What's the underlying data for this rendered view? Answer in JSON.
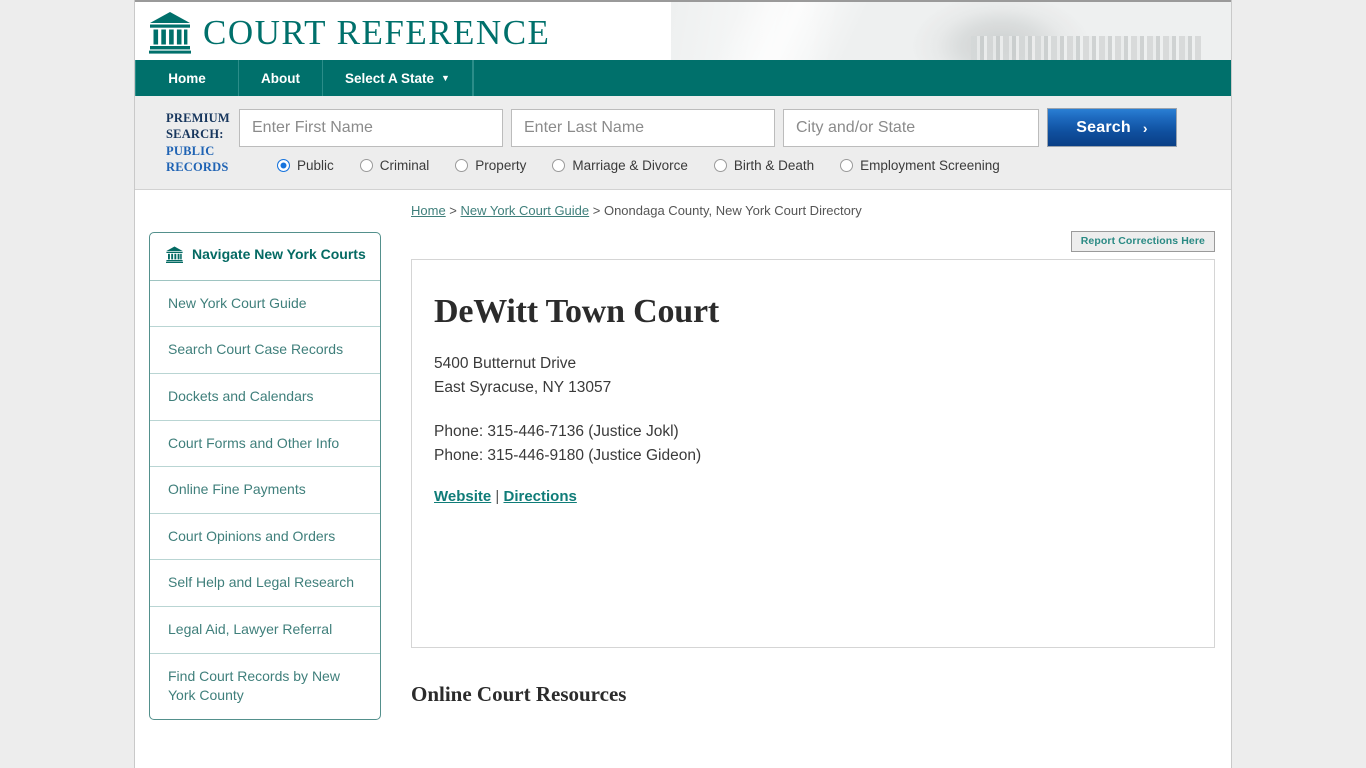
{
  "site": {
    "brand_name": "COURT REFERENCE",
    "brand_icon": "courthouse-icon"
  },
  "nav": {
    "items": [
      {
        "label": "Home"
      },
      {
        "label": "About"
      },
      {
        "label": "Select A State",
        "caret": "▼"
      }
    ]
  },
  "premium_search": {
    "label_line1": "PREMIUM",
    "label_line2": "SEARCH:",
    "label_line3": "PUBLIC",
    "label_line4": "RECORDS",
    "first_name_placeholder": "Enter First Name",
    "first_name_value": "",
    "last_name_placeholder": "Enter Last Name",
    "last_name_value": "",
    "city_state_placeholder": "City and/or State",
    "city_state_value": "",
    "search_button": "Search",
    "search_button_chevron": "›",
    "options": [
      {
        "label": "Public",
        "selected": true
      },
      {
        "label": "Criminal",
        "selected": false
      },
      {
        "label": "Property",
        "selected": false
      },
      {
        "label": "Marriage & Divorce",
        "selected": false
      },
      {
        "label": "Birth & Death",
        "selected": false
      },
      {
        "label": "Employment Screening",
        "selected": false
      }
    ]
  },
  "breadcrumb": {
    "home": "Home",
    "sep1": " > ",
    "guide": "New York Court Guide",
    "sep2": " > ",
    "current": "Onondaga County, New York Court Directory"
  },
  "corrections_button": "Report Corrections Here",
  "sidebar": {
    "heading": "Navigate New York Courts",
    "heading_icon": "courthouse-icon",
    "items": [
      {
        "label": "New York Court Guide"
      },
      {
        "label": "Search Court Case Records"
      },
      {
        "label": "Dockets and Calendars"
      },
      {
        "label": "Court Forms and Other Info"
      },
      {
        "label": "Online Fine Payments"
      },
      {
        "label": "Court Opinions and Orders"
      },
      {
        "label": "Self Help and Legal Research"
      },
      {
        "label": "Legal Aid, Lawyer Referral"
      },
      {
        "label": "Find Court Records by New York County"
      }
    ]
  },
  "court": {
    "title": "DeWitt Town Court",
    "address_line1": "5400 Butternut Drive",
    "address_line2": "East Syracuse, NY 13057",
    "phone_line1": "Phone: 315-446-7136 (Justice Jokl)",
    "phone_line2": "Phone: 315-446-9180 (Justice Gideon)",
    "website_link": "Website",
    "link_divider": " | ",
    "directions_link": "Directions"
  },
  "main": {
    "resources_heading": "Online Court Resources"
  },
  "colors": {
    "teal": "#00706b",
    "link_teal": "#3f7f7b",
    "accent_blue": "#1874dd",
    "page_bg": "#ededed"
  }
}
